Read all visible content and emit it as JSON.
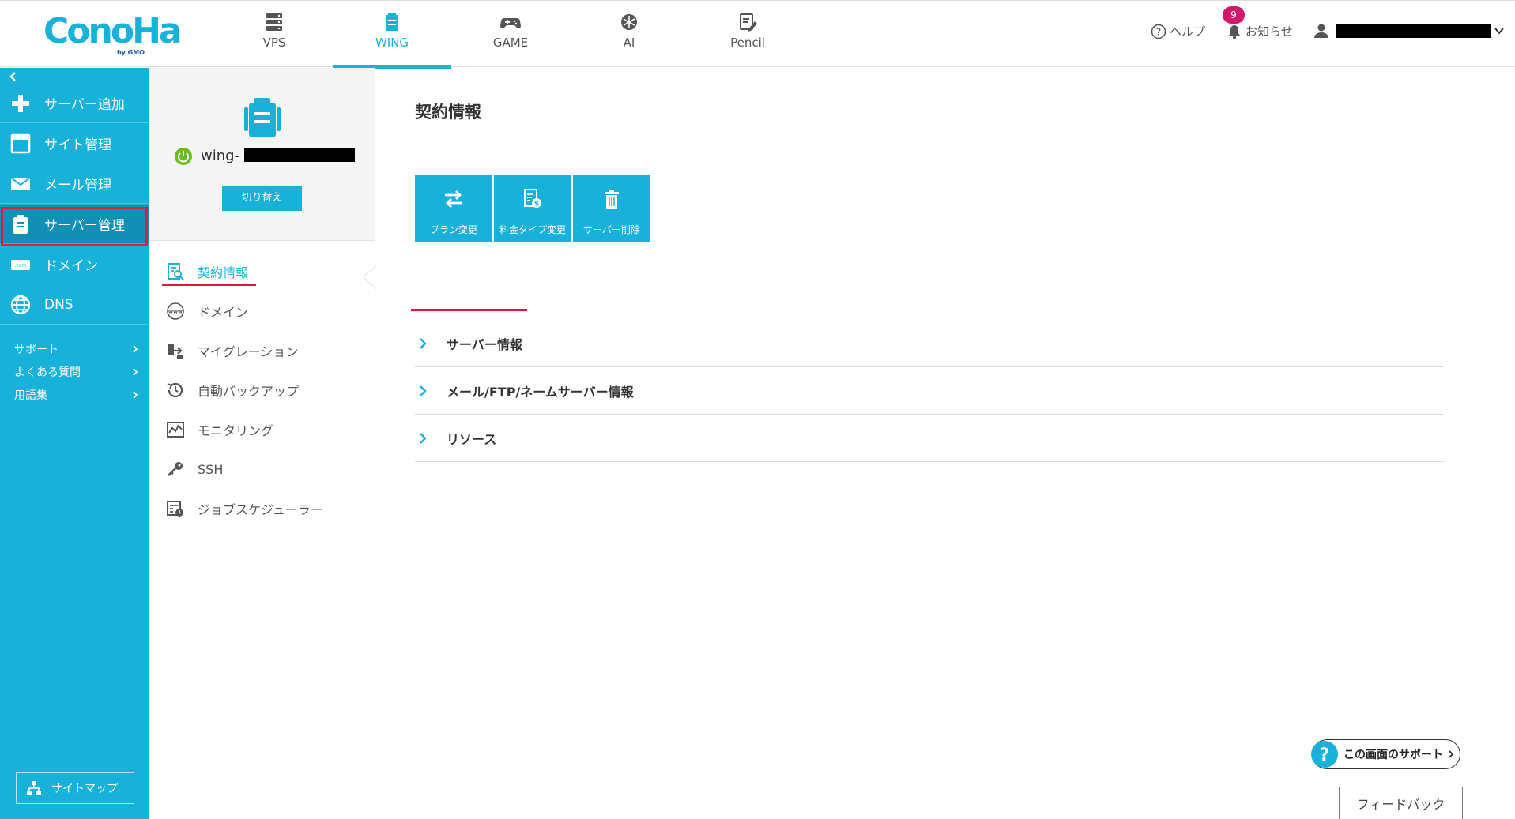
{
  "header": {
    "logo": "ConoHa",
    "logo_sub": "by GMO",
    "tabs": [
      {
        "label": "VPS",
        "icon": "server-stack-icon"
      },
      {
        "label": "WING",
        "icon": "wing-server-icon",
        "active": true
      },
      {
        "label": "GAME",
        "icon": "gamepad-icon"
      },
      {
        "label": "AI",
        "icon": "ai-icon"
      },
      {
        "label": "Pencil",
        "icon": "pencil-doc-icon"
      }
    ],
    "help_label": "ヘルプ",
    "notice_label": "お知らせ",
    "notice_count": "9"
  },
  "sidebar": {
    "items": [
      {
        "label": "サーバー追加",
        "icon": "plus-icon"
      },
      {
        "label": "サイト管理",
        "icon": "window-icon"
      },
      {
        "label": "メール管理",
        "icon": "mail-icon"
      },
      {
        "label": "サーバー管理",
        "icon": "server-icon",
        "selected": true
      },
      {
        "label": "ドメイン",
        "icon": "domain-icon"
      },
      {
        "label": "DNS",
        "icon": "globe-icon"
      }
    ],
    "links": [
      {
        "label": "サポート"
      },
      {
        "label": "よくある質問"
      },
      {
        "label": "用語集"
      }
    ],
    "sitemap_label": "サイトマップ"
  },
  "subbar": {
    "server_name_prefix": "wing-",
    "switch_label": "切り替え",
    "items": [
      {
        "label": "契約情報",
        "icon": "contract-search-icon",
        "current": true
      },
      {
        "label": "ドメイン",
        "icon": "www-icon"
      },
      {
        "label": "マイグレーション",
        "icon": "migration-icon"
      },
      {
        "label": "自動バックアップ",
        "icon": "backup-clock-icon"
      },
      {
        "label": "モニタリング",
        "icon": "monitoring-icon"
      },
      {
        "label": "SSH",
        "icon": "key-icon"
      },
      {
        "label": "ジョブスケジューラー",
        "icon": "scheduler-icon"
      }
    ]
  },
  "main": {
    "title": "契約情報",
    "actions": [
      {
        "label": "プラン変更",
        "icon": "swap-arrows-icon"
      },
      {
        "label": "料金タイプ変更",
        "icon": "price-type-icon"
      },
      {
        "label": "サーバー削除",
        "icon": "trash-icon"
      }
    ],
    "sections": [
      {
        "label": "サーバー情報"
      },
      {
        "label": "メール/FTP/ネームサーバー情報"
      },
      {
        "label": "リソース"
      }
    ],
    "support_label": "この画面のサポート",
    "feedback_label": "フィードバック"
  },
  "colors": {
    "brand": "#17b1d9",
    "sidebar_selected": "#128fb5",
    "highlight": "#d9223a",
    "badge": "#d5176b"
  }
}
